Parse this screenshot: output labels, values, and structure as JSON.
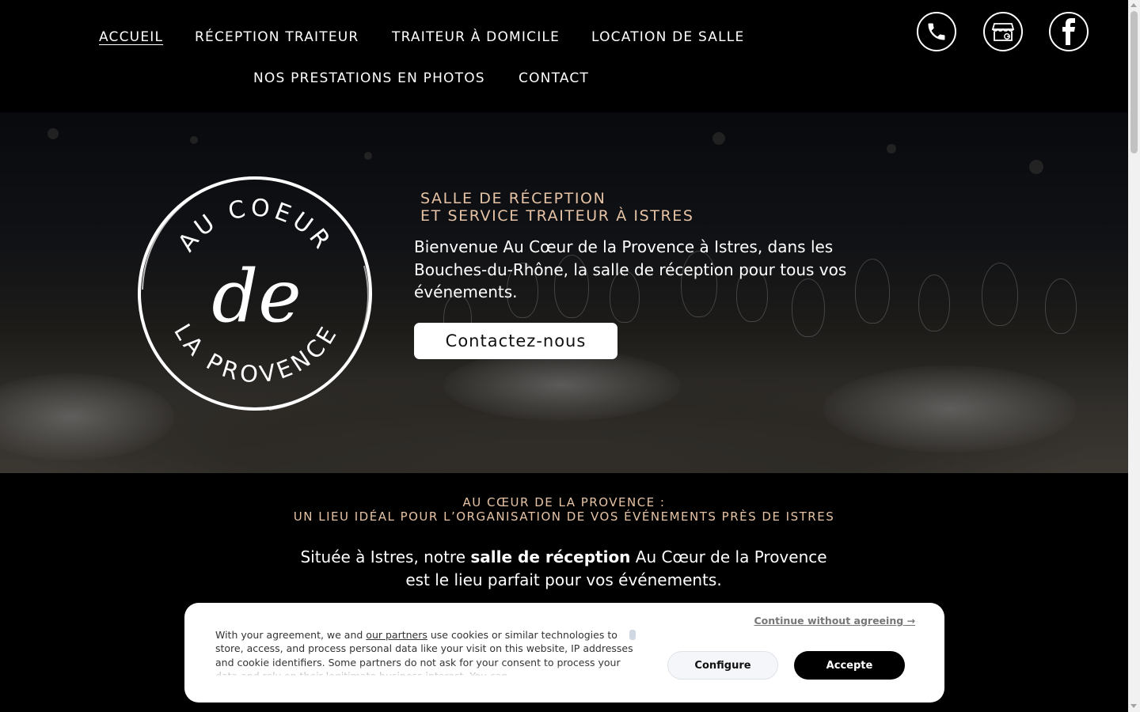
{
  "nav": {
    "items": [
      {
        "label": "ACCUEIL"
      },
      {
        "label": "RÉCEPTION TRAITEUR"
      },
      {
        "label": "TRAITEUR À DOMICILE"
      },
      {
        "label": "LOCATION DE SALLE"
      },
      {
        "label": "NOS PRESTATIONS EN PHOTOS"
      },
      {
        "label": "CONTACT"
      }
    ],
    "active": "ACCUEIL"
  },
  "social": {
    "icons": [
      "phone-icon",
      "google-business-icon",
      "facebook-icon"
    ]
  },
  "hero": {
    "logo": {
      "top_text": "AU COEUR",
      "middle_text": "de",
      "bottom_text": "LA PROVENCE"
    },
    "kicker_line1": "SALLE DE RÉCEPTION",
    "kicker_line2": "ET SERVICE TRAITEUR À ISTRES",
    "text": "Bienvenue Au Cœur de la Provence à Istres, dans les Bouches-du-Rhône, la salle de réception pour tous vos événements.",
    "button": "Contactez-nous"
  },
  "section": {
    "title_line1": "AU CŒUR DE LA PROVENCE :",
    "title_line2": "UN LIEU IDÉAL POUR L’ORGANISATION DE VOS ÉVÉNEMENTS PRÈS DE ISTRES",
    "text_before": "Située à Istres, notre ",
    "text_bold": "salle de réception",
    "text_after": " Au Cœur de la Provence est le lieu parfait pour vos événements."
  },
  "cookie": {
    "text_before": "With your agreement, we and ",
    "link": "our partners",
    "text_after": " use cookies or similar technologies to store, access, and process personal data like your visit on this website, IP addresses and cookie identifiers. Some partners do not ask for your consent to process your data and rely on their legitimate business interest. You can",
    "continue": "Continue without agreeing →",
    "configure": "Configure",
    "accept": "Accepte"
  },
  "colors": {
    "accent": "#e6c3a5",
    "background": "#000000"
  }
}
